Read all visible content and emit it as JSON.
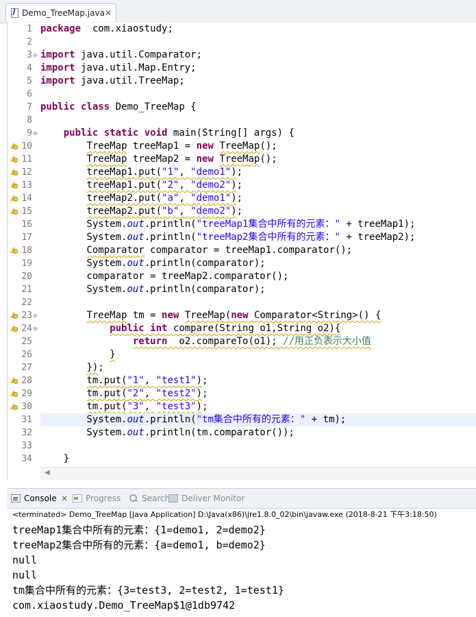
{
  "editor": {
    "tab_title": "Demo_TreeMap.java",
    "tab_close": "✕",
    "lines": [
      {
        "n": "1",
        "parts": [
          [
            "kw",
            "package"
          ],
          [
            "",
            "  com.xiaostudy;"
          ]
        ]
      },
      {
        "n": "2",
        "parts": []
      },
      {
        "n": "3",
        "fold": "⊖",
        "parts": [
          [
            "kw",
            "import"
          ],
          [
            "",
            " java.util.Comparator;"
          ]
        ]
      },
      {
        "n": "4",
        "parts": [
          [
            "kw",
            "import"
          ],
          [
            "",
            " java.util.Map.Entry;"
          ]
        ]
      },
      {
        "n": "5",
        "parts": [
          [
            "kw",
            "import"
          ],
          [
            "",
            " java.util.TreeMap;"
          ]
        ]
      },
      {
        "n": "6",
        "parts": []
      },
      {
        "n": "7",
        "parts": [
          [
            "kw",
            "public"
          ],
          [
            "",
            " "
          ],
          [
            "kw",
            "class"
          ],
          [
            "",
            " Demo_TreeMap {"
          ]
        ]
      },
      {
        "n": "8",
        "parts": []
      },
      {
        "n": "9",
        "fold": "⊖",
        "parts": [
          [
            "",
            "    "
          ],
          [
            "kw",
            "public"
          ],
          [
            "",
            " "
          ],
          [
            "kw",
            "static"
          ],
          [
            "",
            " "
          ],
          [
            "kw",
            "void"
          ],
          [
            "",
            " main(String[] args) {"
          ]
        ]
      },
      {
        "n": "10",
        "warn": true,
        "parts": [
          [
            "",
            "        "
          ],
          [
            "sq",
            "TreeMap"
          ],
          [
            "",
            " treeMap1 = "
          ],
          [
            "kw",
            "new"
          ],
          [
            "",
            " "
          ],
          [
            "sq",
            "TreeMap"
          ],
          [
            "",
            "();"
          ]
        ]
      },
      {
        "n": "11",
        "warn": true,
        "parts": [
          [
            "",
            "        "
          ],
          [
            "sq",
            "TreeMap"
          ],
          [
            "",
            " treeMap2 = "
          ],
          [
            "kw",
            "new"
          ],
          [
            "",
            " "
          ],
          [
            "sq",
            "TreeMap"
          ],
          [
            "",
            "();"
          ]
        ]
      },
      {
        "n": "12",
        "warn": true,
        "parts": [
          [
            "",
            "        "
          ],
          [
            "sq",
            "treeMap1.put("
          ],
          [
            "sqstr",
            "\"1\""
          ],
          [
            "sq",
            ", "
          ],
          [
            "sqstr",
            "\"demo1\""
          ],
          [
            "sq",
            ")"
          ],
          [
            "",
            ";"
          ]
        ]
      },
      {
        "n": "13",
        "warn": true,
        "parts": [
          [
            "",
            "        "
          ],
          [
            "sq",
            "treeMap1.put("
          ],
          [
            "sqstr",
            "\"2\""
          ],
          [
            "sq",
            ", "
          ],
          [
            "sqstr",
            "\"demo2\""
          ],
          [
            "sq",
            ")"
          ],
          [
            "",
            ";"
          ]
        ]
      },
      {
        "n": "14",
        "warn": true,
        "parts": [
          [
            "",
            "        "
          ],
          [
            "sq",
            "treeMap2.put("
          ],
          [
            "sqstr",
            "\"a\""
          ],
          [
            "sq",
            ", "
          ],
          [
            "sqstr",
            "\"demo1\""
          ],
          [
            "sq",
            ")"
          ],
          [
            "",
            ";"
          ]
        ]
      },
      {
        "n": "15",
        "warn": true,
        "parts": [
          [
            "",
            "        "
          ],
          [
            "sq",
            "treeMap2.put("
          ],
          [
            "sqstr",
            "\"b\""
          ],
          [
            "sq",
            ", "
          ],
          [
            "sqstr",
            "\"demo2\""
          ],
          [
            "sq",
            ")"
          ],
          [
            "",
            ";"
          ]
        ]
      },
      {
        "n": "16",
        "parts": [
          [
            "",
            "        System."
          ],
          [
            "fld",
            "out"
          ],
          [
            "",
            ".println("
          ],
          [
            "str",
            "\"treeMap1集合中所有的元素：\""
          ],
          [
            "",
            " + treeMap1);"
          ]
        ]
      },
      {
        "n": "17",
        "parts": [
          [
            "",
            "        System."
          ],
          [
            "fld",
            "out"
          ],
          [
            "",
            ".println("
          ],
          [
            "str",
            "\"treeMap2集合中所有的元素：\""
          ],
          [
            "",
            " + treeMap2);"
          ]
        ]
      },
      {
        "n": "18",
        "warn": true,
        "parts": [
          [
            "",
            "        "
          ],
          [
            "sq",
            "Comparator"
          ],
          [
            "",
            " comparator = treeMap1.comparator();"
          ]
        ]
      },
      {
        "n": "19",
        "parts": [
          [
            "",
            "        System."
          ],
          [
            "fld",
            "out"
          ],
          [
            "",
            ".println(comparator);"
          ]
        ]
      },
      {
        "n": "20",
        "parts": [
          [
            "",
            "        comparator = treeMap2.comparator();"
          ]
        ]
      },
      {
        "n": "21",
        "parts": [
          [
            "",
            "        System."
          ],
          [
            "fld",
            "out"
          ],
          [
            "",
            ".println(comparator);"
          ]
        ]
      },
      {
        "n": "22",
        "parts": []
      },
      {
        "n": "23",
        "warn": true,
        "fold": "⊖",
        "parts": [
          [
            "",
            "        "
          ],
          [
            "sq",
            "TreeMap"
          ],
          [
            "",
            " tm = "
          ],
          [
            "kw",
            "new"
          ],
          [
            "",
            " "
          ],
          [
            "sq",
            "TreeMap"
          ],
          [
            "sq",
            "("
          ],
          [
            "sqkw",
            "new"
          ],
          [
            "sq",
            " Comparator<String>() {"
          ]
        ]
      },
      {
        "n": "24",
        "warn": true,
        "fold": "⊖",
        "parts": [
          [
            "",
            "            "
          ],
          [
            "sqkw",
            "public"
          ],
          [
            "sq",
            " "
          ],
          [
            "sqkw",
            "int"
          ],
          [
            "sq",
            " compare(String o1,String o2){"
          ]
        ]
      },
      {
        "n": "25",
        "parts": [
          [
            "",
            "                "
          ],
          [
            "sqkw",
            "return"
          ],
          [
            "sq",
            "  o2.compareTo(o1); "
          ],
          [
            "sqcmt",
            "//用正负表示大小值"
          ]
        ]
      },
      {
        "n": "26",
        "parts": [
          [
            "",
            "            "
          ],
          [
            "sq",
            "}"
          ]
        ]
      },
      {
        "n": "27",
        "parts": [
          [
            "",
            "        "
          ],
          [
            "sq",
            "})"
          ],
          [
            "",
            ";"
          ]
        ]
      },
      {
        "n": "28",
        "warn": true,
        "parts": [
          [
            "",
            "        "
          ],
          [
            "sq",
            "tm.put("
          ],
          [
            "sqstr",
            "\"1\""
          ],
          [
            "sq",
            ", "
          ],
          [
            "sqstr",
            "\"test1\""
          ],
          [
            "sq",
            ")"
          ],
          [
            "",
            ";"
          ]
        ]
      },
      {
        "n": "29",
        "warn": true,
        "parts": [
          [
            "",
            "        "
          ],
          [
            "sq",
            "tm.put("
          ],
          [
            "sqstr",
            "\"2\""
          ],
          [
            "sq",
            ", "
          ],
          [
            "sqstr",
            "\"test2\""
          ],
          [
            "sq",
            ")"
          ],
          [
            "",
            ";"
          ]
        ]
      },
      {
        "n": "30",
        "warn": true,
        "parts": [
          [
            "",
            "        "
          ],
          [
            "sq",
            "tm.put("
          ],
          [
            "sqstr",
            "\"3\""
          ],
          [
            "sq",
            ", "
          ],
          [
            "sqstr",
            "\"test3\""
          ],
          [
            "sq",
            ")"
          ],
          [
            "",
            ";"
          ]
        ]
      },
      {
        "n": "31",
        "hl": true,
        "parts": [
          [
            "",
            "        System."
          ],
          [
            "fld",
            "out"
          ],
          [
            "",
            ".println("
          ],
          [
            "str",
            "\"tm集合中所有的元素：\""
          ],
          [
            "",
            " + tm);"
          ]
        ]
      },
      {
        "n": "32",
        "parts": [
          [
            "",
            "        System."
          ],
          [
            "fld",
            "out"
          ],
          [
            "",
            ".println(tm.comparator());"
          ]
        ]
      },
      {
        "n": "33",
        "parts": []
      },
      {
        "n": "34",
        "parts": [
          [
            "",
            "    }"
          ]
        ]
      }
    ]
  },
  "console": {
    "tabs": [
      {
        "label": "Console",
        "icon": "console-icon",
        "active": true,
        "close": "✕"
      },
      {
        "label": "Progress",
        "icon": "progress-icon",
        "active": false
      },
      {
        "label": "Search",
        "icon": "search-icon",
        "active": false
      },
      {
        "label": "Deliver Monitor",
        "icon": "deliver-monitor-icon",
        "active": false
      }
    ],
    "status": "<terminated> Demo_TreeMap [Java Application] D:\\Java(x86)\\jre1.8.0_02\\bin\\javaw.exe (2018-8-21 下午3:18:50)",
    "output": [
      "treeMap1集合中所有的元素：{1=demo1, 2=demo2}",
      "treeMap2集合中所有的元素：{a=demo1, b=demo2}",
      "null",
      "null",
      "tm集合中所有的元素：{3=test3, 2=test2, 1=test1}",
      "com.xiaostudy.Demo_TreeMap$1@1db9742"
    ]
  }
}
